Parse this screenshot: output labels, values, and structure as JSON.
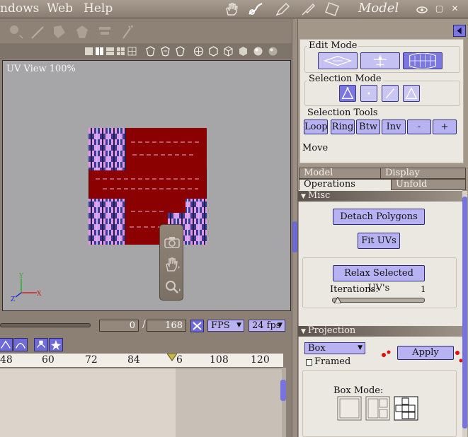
{
  "menu": {
    "items": [
      "ndows",
      "Web",
      "Help"
    ],
    "mode_title": "Model",
    "window_buttons": [
      "eye-icon",
      "restore-icon",
      "close-icon"
    ]
  },
  "toolbar": {
    "mode_icons": [
      "hand-icon",
      "sculpt-icon",
      "paint-icon",
      "brush-icon",
      "uv-icon"
    ]
  },
  "viewport": {
    "label": "UV View 100%",
    "axes": {
      "y": "Y",
      "x": "X",
      "z": "Z"
    },
    "colors": {
      "background": "#a6a6a9",
      "texture_red": "#8b0000",
      "check_pink": "#e596e6",
      "check_blue": "#3b3d94"
    }
  },
  "timeline": {
    "current_frame": "0",
    "separator": "/",
    "total_frames": "168",
    "fps_mode": "FPS",
    "fps_value": "24 fps",
    "ruler_ticks": [
      "48",
      "60",
      "72",
      "84",
      "96",
      "108",
      "120"
    ],
    "shown_ticks": [
      "48",
      "60",
      "72",
      "84",
      "6",
      "108",
      "120"
    ]
  },
  "panel": {
    "edit_mode": {
      "title": "Edit Mode",
      "active_index": 2
    },
    "selection_mode": {
      "title": "Selection Mode",
      "active_index": 0
    },
    "selection_tools": {
      "title": "Selection Tools",
      "buttons": [
        "Loop",
        "Ring",
        "Btw",
        "Inv",
        "-",
        "+"
      ]
    },
    "move_label": "Move",
    "tabs": {
      "model": "Model",
      "display": "Display",
      "operations": "Operations",
      "unfold": "Unfold"
    },
    "misc": {
      "header": "Misc",
      "detach": "Detach Polygons",
      "fit_uvs": "Fit UVs",
      "relax": "Relax Selected UV's",
      "iterations_label": "Iterations:",
      "iterations_value": "1"
    },
    "projection": {
      "header": "Projection",
      "type": "Box",
      "apply": "Apply",
      "framed_label": "Framed",
      "box_mode_label": "Box Mode:"
    },
    "accent_color": "#7b77e0"
  }
}
